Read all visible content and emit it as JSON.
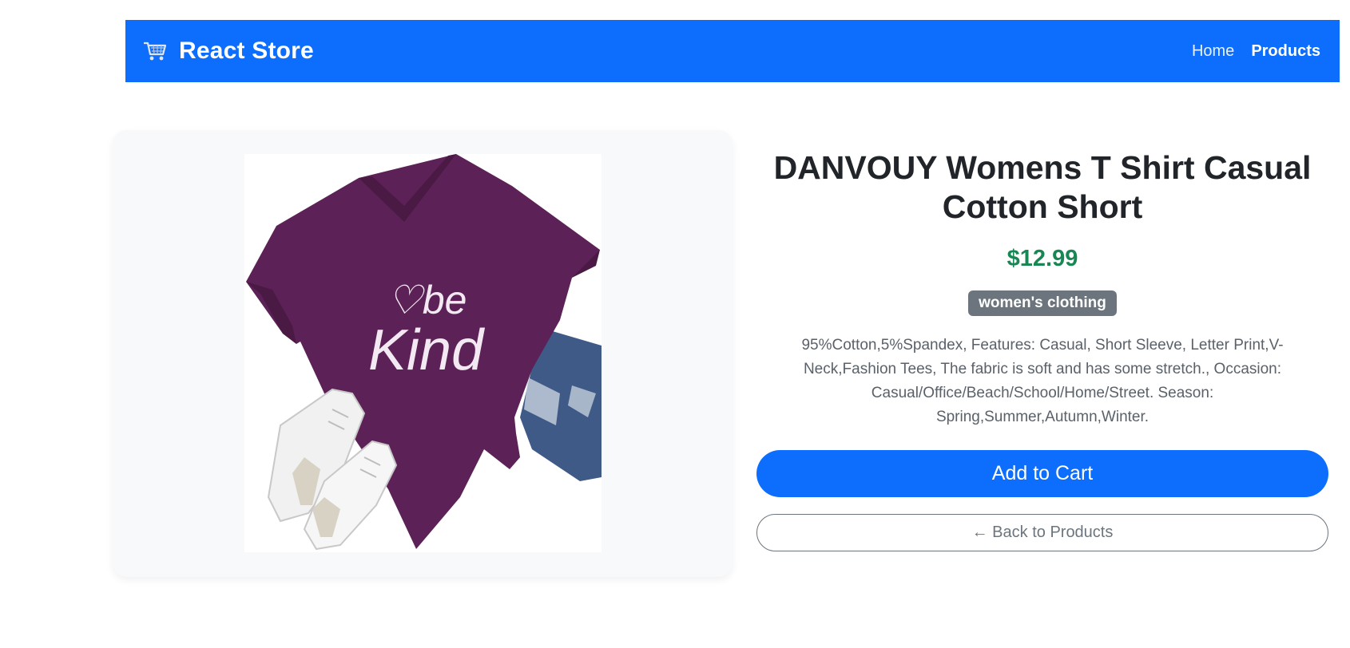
{
  "navbar": {
    "brand": "React Store",
    "brand_icon": "shopping-cart-icon",
    "background": "#0d6efd",
    "links": [
      {
        "label": "Home",
        "active": false
      },
      {
        "label": "Products",
        "active": true
      }
    ]
  },
  "product": {
    "image_icon": "product-photo",
    "image_text": "be Kind",
    "title": "DANVOUY Womens T Shirt Casual Cotton Short",
    "price": "$12.99",
    "price_color": "#198754",
    "category": "women's clothing",
    "description": "95%Cotton,5%Spandex, Features: Casual, Short Sleeve, Letter Print,V-Neck,Fashion Tees, The fabric is soft and has some stretch., Occasion: Casual/Office/Beach/School/Home/Street. Season: Spring,Summer,Autumn,Winter."
  },
  "actions": {
    "add_to_cart": "Add to Cart",
    "back": "← Back to Products"
  }
}
